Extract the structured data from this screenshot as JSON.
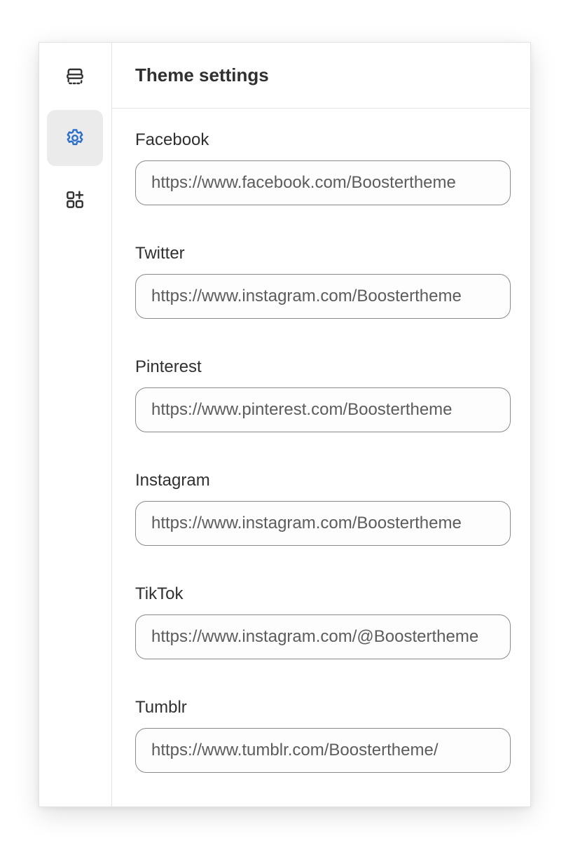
{
  "panel": {
    "title": "Theme settings"
  },
  "sidebar": {
    "items": [
      {
        "icon": "sections-icon",
        "active": false
      },
      {
        "icon": "gear-icon",
        "active": true,
        "color": "#2c6ecb"
      },
      {
        "icon": "add-apps-icon",
        "active": false
      }
    ]
  },
  "fields": [
    {
      "label": "Facebook",
      "value": "https://www.facebook.com/Boostertheme"
    },
    {
      "label": "Twitter",
      "value": "https://www.instagram.com/Boostertheme"
    },
    {
      "label": "Pinterest",
      "value": "https://www.pinterest.com/Boostertheme"
    },
    {
      "label": "Instagram",
      "value": "https://www.instagram.com/Boostertheme"
    },
    {
      "label": "TikTok",
      "value": "https://www.instagram.com/@Boostertheme"
    },
    {
      "label": "Tumblr",
      "value": "https://www.tumblr.com/Boostertheme/"
    }
  ]
}
